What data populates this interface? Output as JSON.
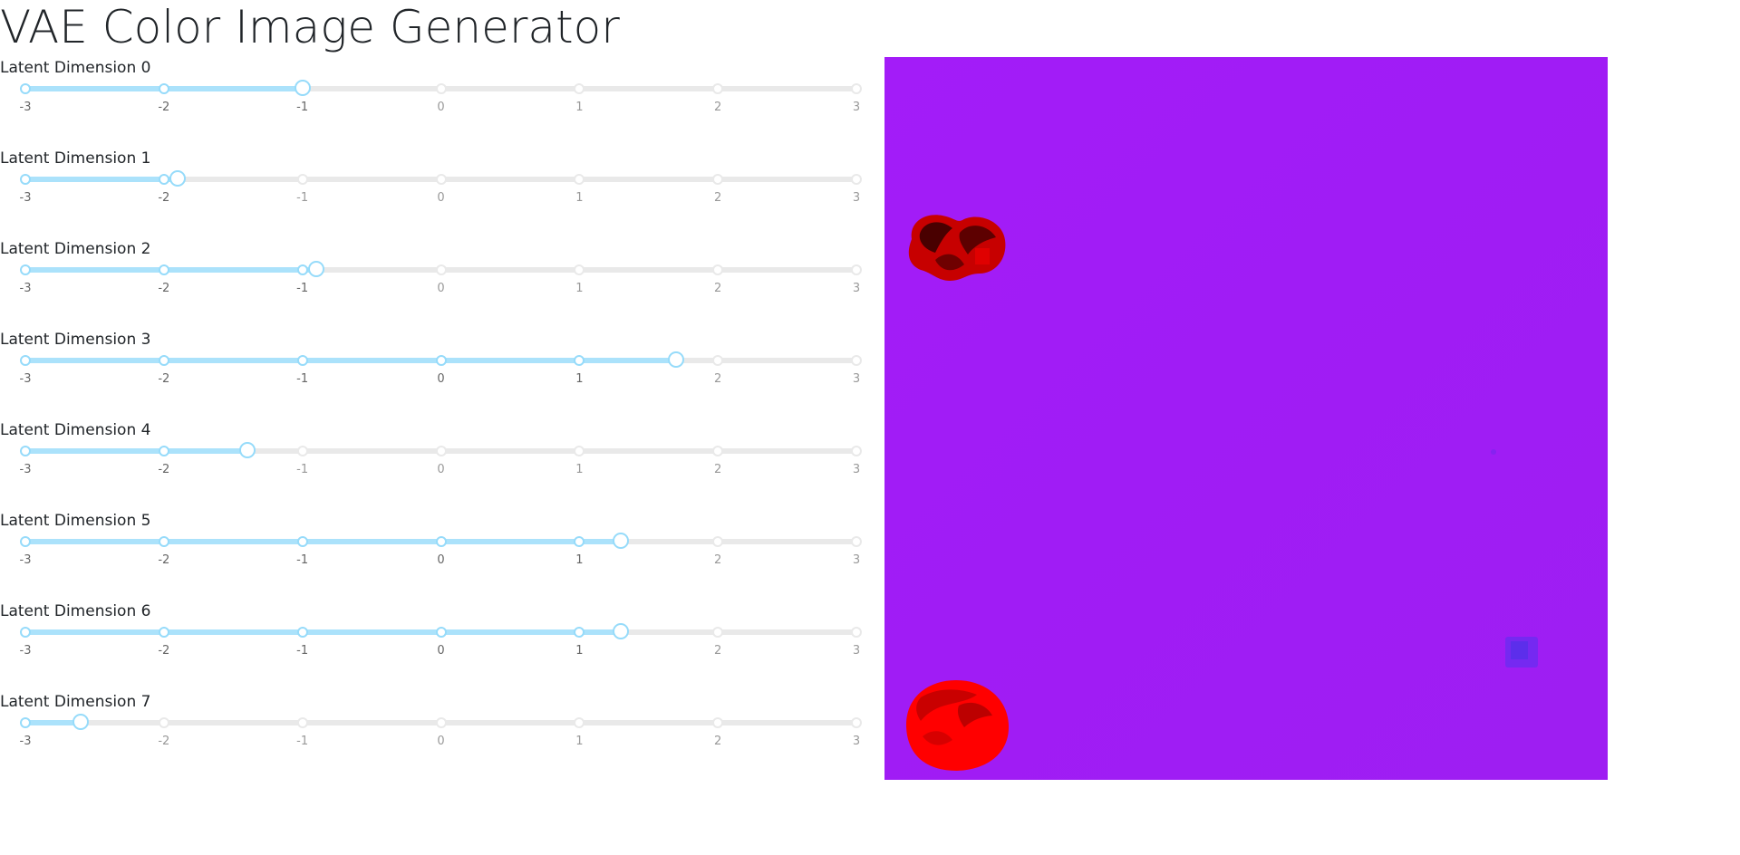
{
  "page": {
    "title": "VAE Color Image Generator"
  },
  "sliders": [
    {
      "label": "Latent Dimension 0",
      "value": -1.0
    },
    {
      "label": "Latent Dimension 1",
      "value": -1.9
    },
    {
      "label": "Latent Dimension 2",
      "value": -0.9
    },
    {
      "label": "Latent Dimension 3",
      "value": 1.7
    },
    {
      "label": "Latent Dimension 4",
      "value": -1.4
    },
    {
      "label": "Latent Dimension 5",
      "value": 1.3
    },
    {
      "label": "Latent Dimension 6",
      "value": 1.3
    },
    {
      "label": "Latent Dimension 7",
      "value": -2.6
    }
  ],
  "slider_scale": {
    "min": -3,
    "max": 3,
    "marks": [
      "-3",
      "-2",
      "-1",
      "0",
      "1",
      "2",
      "3"
    ]
  },
  "colors": {
    "background": "#ffffff",
    "text": "#212529",
    "slider_rail": "#e9e9e9",
    "slider_track": "#abe2fb",
    "slider_handle_border": "#96dbfa",
    "mark_inactive": "#999999",
    "mark_active": "#666666",
    "image_background": "#a01cf5",
    "image_red_shape": "#ff0000",
    "image_blue_shape": "#6a2cf0"
  }
}
